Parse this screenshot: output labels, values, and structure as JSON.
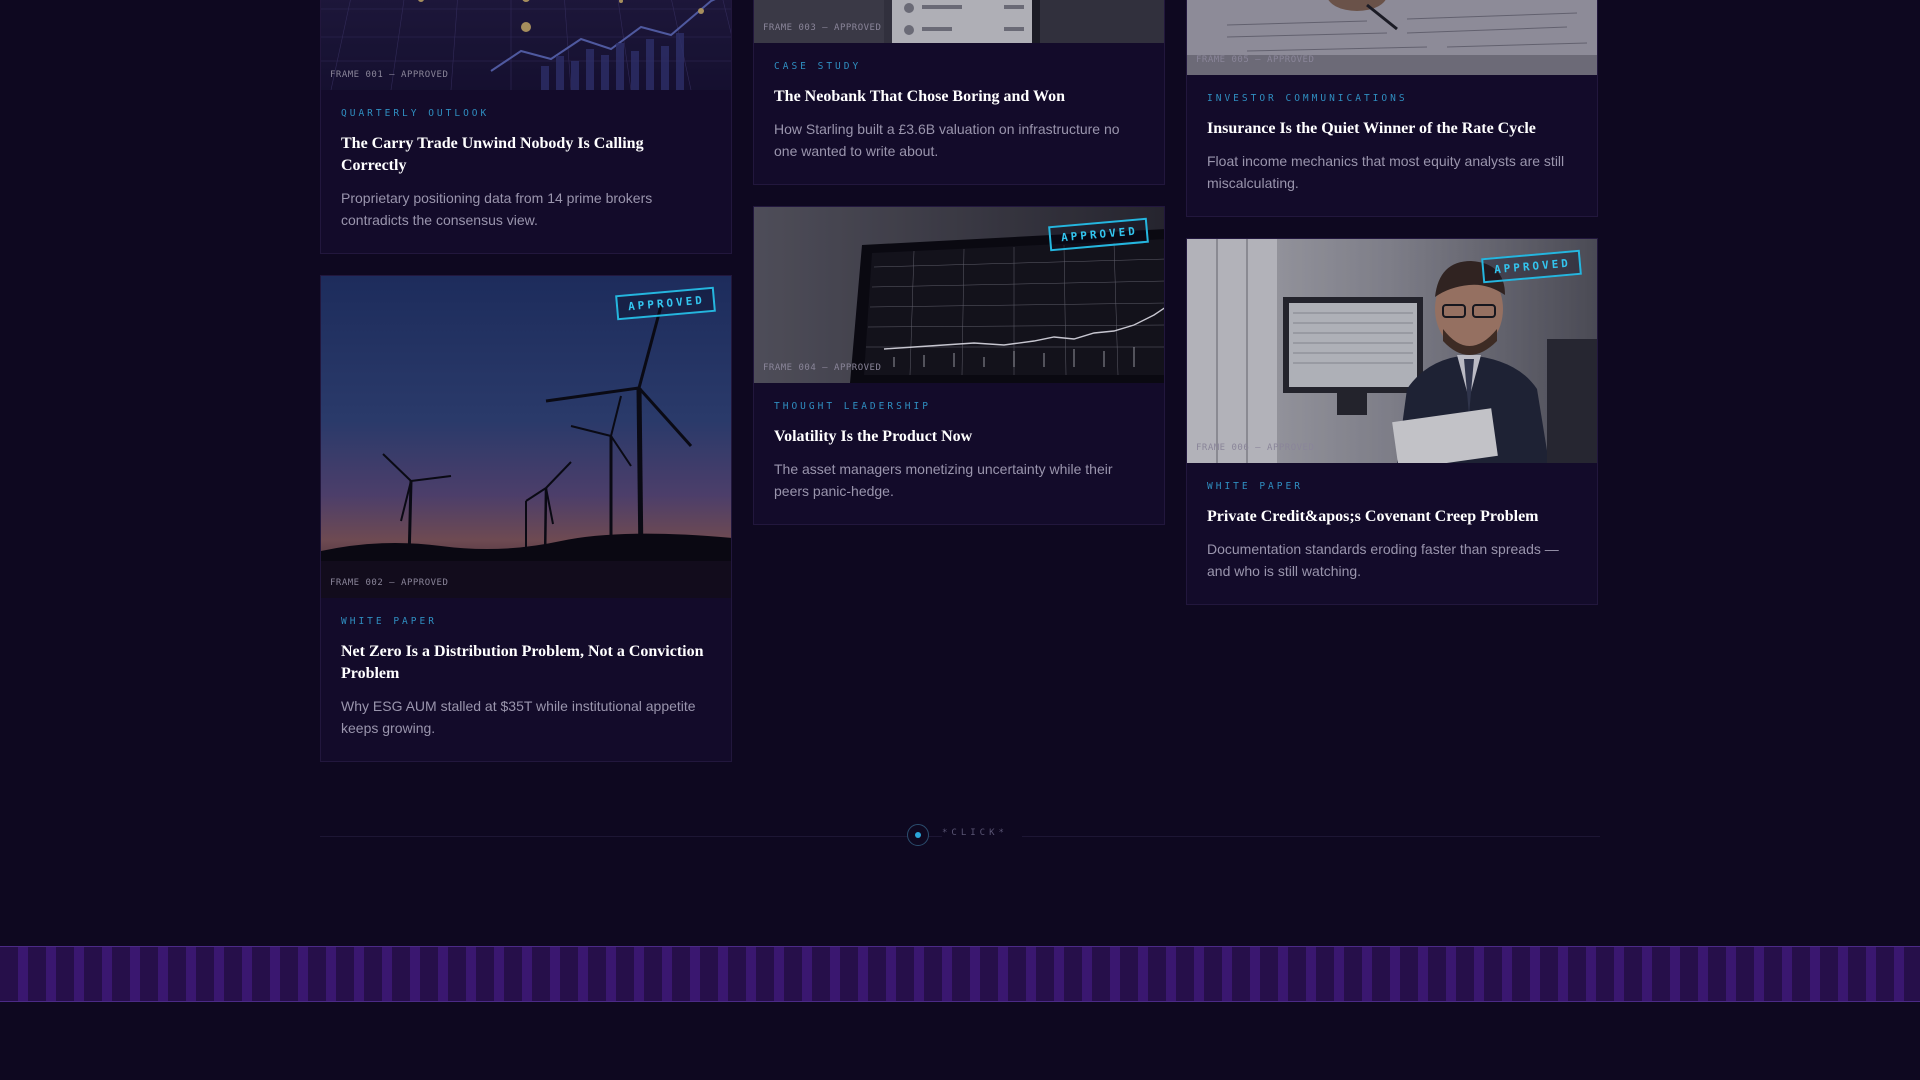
{
  "cards": [
    {
      "frame_caption": "FRAME 001 — APPROVED",
      "category": "QUARTERLY OUTLOOK",
      "title": "The Carry Trade Unwind Nobody Is Calling Correctly",
      "description": "Proprietary positioning data from 14 prime brokers contradicts the consensus view.",
      "stamp": "",
      "image": "network-grid"
    },
    {
      "frame_caption": "FRAME 002 — APPROVED",
      "category": "WHITE PAPER",
      "title": "Net Zero Is a Distribution Problem, Not a Conviction Problem",
      "description": "Why ESG AUM stalled at $35T while institutional appetite keeps growing.",
      "stamp": "APPROVED",
      "image": "wind-turbines"
    },
    {
      "frame_caption": "FRAME 003 — APPROVED",
      "category": "CASE STUDY",
      "title": "The Neobank That Chose Boring and Won",
      "description": "How Starling built a £3.6B valuation on infrastructure no one wanted to write about.",
      "stamp": "",
      "image": "banking-app"
    },
    {
      "frame_caption": "FRAME 004 — APPROVED",
      "category": "THOUGHT LEADERSHIP",
      "title": "Volatility Is the Product Now",
      "description": "The asset managers monetizing uncertainty while their peers panic-hedge.",
      "stamp": "APPROVED",
      "image": "trading-screen"
    },
    {
      "frame_caption": "FRAME 005 — APPROVED",
      "category": "INVESTOR COMMUNICATIONS",
      "title": "Insurance Is the Quiet Winner of the Rate Cycle",
      "description": "Float income mechanics that most equity analysts are still miscalculating.",
      "stamp": "",
      "image": "documents-desk"
    },
    {
      "frame_caption": "FRAME 006 — APPROVED",
      "category": "WHITE PAPER",
      "title": "Private Credit&apos;s Covenant Creep Problem",
      "description": "Documentation standards eroding faster than spreads — and who is still watching.",
      "stamp": "APPROVED",
      "image": "analyst-office"
    }
  ],
  "footer": {
    "click_label": "*CLICK*"
  },
  "colors": {
    "background": "#0e0820",
    "card": "#130b2a",
    "accent": "#25b6df",
    "category": "#2f8ec0",
    "stripe": "#3a1770"
  }
}
